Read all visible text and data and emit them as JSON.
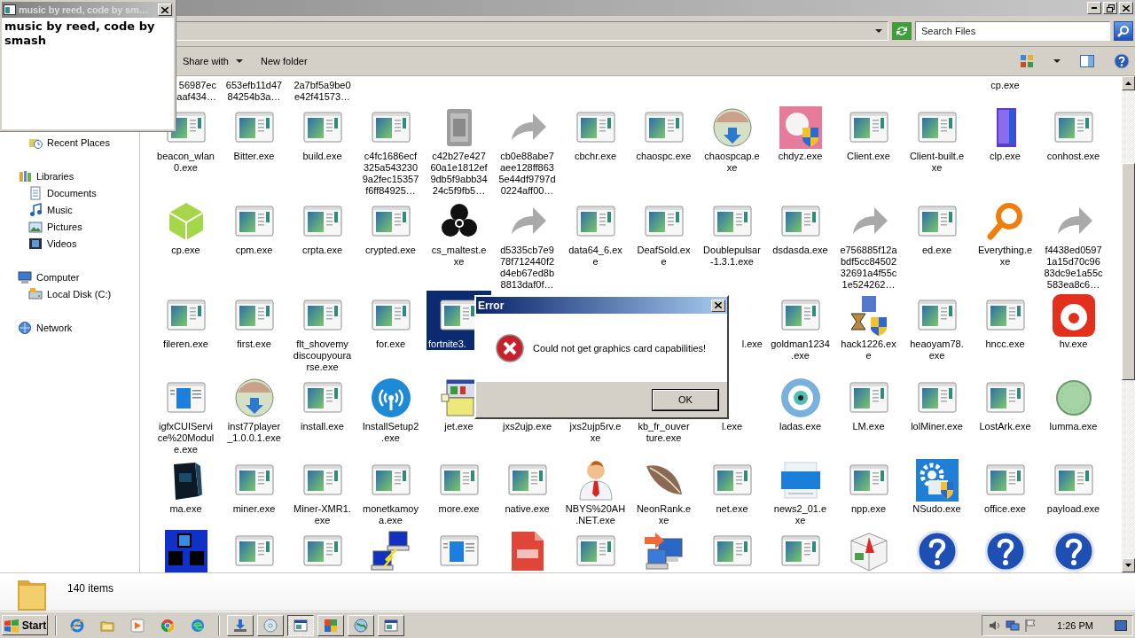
{
  "mini_window": {
    "title": "music by reed, code by sm…",
    "text": "music by reed, code by smash"
  },
  "explorer": {
    "search": {
      "placeholder": "Search Files"
    },
    "toolbar": [
      {
        "label": "Share with",
        "dropdown": true
      },
      {
        "label": "New folder",
        "dropdown": false
      }
    ],
    "nav": [
      {
        "children": [
          {
            "label": "Recent Places",
            "kind": "recent"
          }
        ]
      },
      {
        "label": "Libraries",
        "kind": "library",
        "children": [
          {
            "label": "Documents",
            "kind": "documents"
          },
          {
            "label": "Music",
            "kind": "music"
          },
          {
            "label": "Pictures",
            "kind": "pictures"
          },
          {
            "label": "Videos",
            "kind": "videos"
          }
        ]
      },
      {
        "label": "Computer",
        "kind": "computer",
        "children": [
          {
            "label": "Local Disk (C:)",
            "kind": "disk"
          }
        ]
      },
      {
        "label": "Network",
        "kind": "network"
      }
    ],
    "grid": {
      "rows": [
        [
          {
            "label": "56987ec\naaf434…",
            "selected": false
          },
          {
            "label": "653efb11d47\n84254b3a…",
            "selected": false
          },
          {
            "label": "2a7bf5a9be0\ne42f41573…",
            "selected": false
          },
          {},
          {},
          {},
          {},
          {},
          {},
          {},
          {},
          {},
          {
            "label": "cp.exe",
            "selected": false
          },
          {}
        ],
        [
          {
            "label": "beacon_wlan\n0.exe",
            "kind": "app",
            "selected": false
          },
          {
            "label": "Bitter.exe",
            "kind": "app",
            "selected": false
          },
          {
            "label": "build.exe",
            "kind": "app",
            "selected": false
          },
          {
            "label": "c4fc1686ecf\n325a543230\n9a2fec15357\nf6ff84925…",
            "kind": "app",
            "selected": false
          },
          {
            "label": "c42b27e427\n60a1e1812ef\n9db5f9abb34\n24c5f9fb5…",
            "kind": "grayfile",
            "selected": false
          },
          {
            "label": "cb0e88abe7\naee128ff863\n5e44df9797d\n0224aff00…",
            "kind": "shortcut",
            "selected": false
          },
          {
            "label": "cbchr.exe",
            "kind": "app",
            "selected": false
          },
          {
            "label": "chaospc.exe",
            "kind": "app",
            "selected": false
          },
          {
            "label": "chaospcap.e\nxe",
            "kind": "disc",
            "selected": false
          },
          {
            "label": "chdyz.exe",
            "kind": "shieldtile",
            "selected": false
          },
          {
            "label": "Client.exe",
            "kind": "app",
            "selected": false
          },
          {
            "label": "Client-built.e\nxe",
            "kind": "app",
            "selected": false
          },
          {
            "label": "clp.exe",
            "kind": "box",
            "selected": false
          },
          {
            "label": "conhost.exe",
            "kind": "app",
            "selected": false
          }
        ],
        [
          {
            "label": "cp.exe",
            "kind": "cube",
            "selected": false
          },
          {
            "label": "cpm.exe",
            "kind": "app",
            "selected": false
          },
          {
            "label": "crpta.exe",
            "kind": "app",
            "selected": false
          },
          {
            "label": "crypted.exe",
            "kind": "app",
            "selected": false
          },
          {
            "label": "cs_maltest.e\nxe",
            "kind": "biohazard",
            "selected": false
          },
          {
            "label": "d5335cb7e9\n78f712440f2\nd4eb67ed8b\n8813daf0f…",
            "kind": "shortcut",
            "selected": false
          },
          {
            "label": "data64_6.ex\ne",
            "kind": "app",
            "selected": false
          },
          {
            "label": "DeafSold.ex\ne",
            "kind": "app",
            "selected": false
          },
          {
            "label": "Doublepulsar\n-1.3.1.exe",
            "kind": "app",
            "selected": false
          },
          {
            "label": "dsdasda.exe",
            "kind": "app",
            "selected": false
          },
          {
            "label": "e756885f12a\nbdf5cc84502\n32691a4f55c\n1e524262…",
            "kind": "shortcut",
            "selected": false
          },
          {
            "label": "ed.exe",
            "kind": "app",
            "selected": false
          },
          {
            "label": "Everything.e\nxe",
            "kind": "magnifier",
            "selected": false
          },
          {
            "label": "f4438ed0597\n1a15d70c96\n83dc9e1a55c\n583ea8c6…",
            "kind": "shortcut",
            "selected": false
          }
        ],
        [
          {
            "label": "fileren.exe",
            "kind": "app",
            "selected": false
          },
          {
            "label": "first.exe",
            "kind": "app",
            "selected": false
          },
          {
            "label": "flt_shovemy\ndiscoupyoura\nrse.exe",
            "kind": "app",
            "selected": false
          },
          {
            "label": "for.exe",
            "kind": "app",
            "selected": false
          },
          {
            "label": "fortnite3.",
            "kind": "app",
            "selected": true
          },
          {},
          {},
          {},
          {
            "label": "l.exe",
            "selected": false
          },
          {
            "label": "goldman1234\n.exe",
            "kind": "app",
            "selected": false
          },
          {
            "label": "hack1226.ex\ne",
            "kind": "hourglass",
            "selected": false
          },
          {
            "label": "heaoyam78.\nexe",
            "kind": "app",
            "selected": false
          },
          {
            "label": "hncc.exe",
            "kind": "app",
            "selected": false
          },
          {
            "label": "hv.exe",
            "kind": "ring",
            "selected": false
          }
        ],
        [
          {
            "label": "igfxCUIServi\nce%20Modul\ne.exe",
            "kind": "appblue",
            "selected": false
          },
          {
            "label": "inst77player\n_1.0.0.1.exe",
            "kind": "disc",
            "selected": false
          },
          {
            "label": "install.exe",
            "kind": "app",
            "selected": false
          },
          {
            "label": "InstallSetup2\n.exe",
            "kind": "signal",
            "selected": false
          },
          {
            "label": "jet.exe",
            "kind": "package",
            "selected": false
          },
          {
            "label": "jxs2ujp.exe",
            "selected": false
          },
          {
            "label": "jxs2ujp5rv.e\nxe",
            "selected": false
          },
          {
            "label": "kb_fr_ouver\nture.exe",
            "selected": false
          },
          {
            "label": "l.exe",
            "selected": false
          },
          {
            "label": "ladas.exe",
            "kind": "eye",
            "selected": false
          },
          {
            "label": "LM.exe",
            "kind": "app",
            "selected": false
          },
          {
            "label": "lolMiner.exe",
            "kind": "app",
            "selected": false
          },
          {
            "label": "LostArk.exe",
            "kind": "app",
            "selected": false
          },
          {
            "label": "lumma.exe",
            "kind": "roundel",
            "selected": false
          }
        ],
        [
          {
            "label": "ma.exe",
            "kind": "softbox",
            "selected": false
          },
          {
            "label": "miner.exe",
            "kind": "app",
            "selected": false
          },
          {
            "label": "Miner-XMR1.\nexe",
            "kind": "app",
            "selected": false
          },
          {
            "label": "monetkamoy\na.exe",
            "kind": "app",
            "selected": false
          },
          {
            "label": "more.exe",
            "kind": "app",
            "selected": false
          },
          {
            "label": "native.exe",
            "kind": "app",
            "selected": false
          },
          {
            "label": "NBYS%20AH\n.NET.exe",
            "kind": "person",
            "selected": false
          },
          {
            "label": "NeonRank.e\nxe",
            "kind": "feather",
            "selected": false
          },
          {
            "label": "net.exe",
            "kind": "app",
            "selected": false
          },
          {
            "label": "news2_01.e\nxe",
            "kind": "news",
            "selected": false
          },
          {
            "label": "npp.exe",
            "kind": "app",
            "selected": false
          },
          {
            "label": "NSudo.exe",
            "kind": "gear",
            "selected": false
          },
          {
            "label": "office.exe",
            "kind": "app",
            "selected": false
          },
          {
            "label": "payload.exe",
            "kind": "app",
            "selected": false
          }
        ],
        [
          {
            "kind": "blocks",
            "selected": false
          },
          {
            "kind": "app",
            "selected": false
          },
          {
            "kind": "app",
            "selected": false
          },
          {
            "kind": "network",
            "selected": false
          },
          {
            "kind": "appblue",
            "selected": false
          },
          {
            "kind": "pdf",
            "selected": false
          },
          {
            "kind": "app",
            "selected": false
          },
          {
            "kind": "computers",
            "selected": false
          },
          {
            "kind": "app",
            "selected": false
          },
          {
            "kind": "app",
            "selected": false
          },
          {
            "kind": "dice",
            "selected": false
          },
          {
            "kind": "help",
            "selected": false
          },
          {
            "kind": "help",
            "selected": false
          },
          {
            "kind": "help",
            "selected": false
          }
        ]
      ]
    },
    "status": "140 items"
  },
  "dialog": {
    "title": "Error",
    "message": "Could not get graphics card capabilities!",
    "button": "OK"
  },
  "taskbar": {
    "start": "Start",
    "quick_launch": [
      {
        "kind": "browser-e"
      },
      {
        "kind": "folder"
      },
      {
        "kind": "media"
      },
      {
        "kind": "chrome"
      },
      {
        "kind": "edge"
      }
    ],
    "tasks": [
      {
        "kind": "download",
        "selected": false
      },
      {
        "kind": "disc",
        "selected": false
      },
      {
        "kind": "window",
        "selected": true
      },
      {
        "kind": "tiles",
        "selected": false
      },
      {
        "kind": "globe",
        "selected": false
      },
      {
        "kind": "window",
        "selected": false
      }
    ],
    "tray": [
      {
        "kind": "speaker"
      },
      {
        "kind": "network"
      },
      {
        "kind": "flag"
      }
    ],
    "clock": "1:26 PM"
  }
}
